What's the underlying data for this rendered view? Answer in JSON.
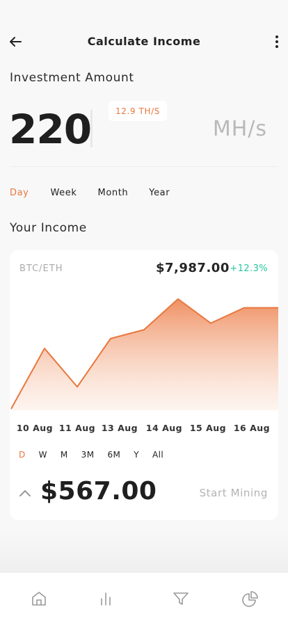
{
  "header": {
    "title": "Calculate Income",
    "back_icon": "arrow-left-icon",
    "menu_icon": "more-vertical-icon"
  },
  "investment": {
    "label": "Investment Amount",
    "amount": "220",
    "hashrate_badge": "12.9 TH/S",
    "unit": "MH/s"
  },
  "period_tabs": [
    "Day",
    "Week",
    "Month",
    "Year"
  ],
  "period_active": "Day",
  "income": {
    "label": "Your Income",
    "pair": "BTC/ETH",
    "price": "$7,987.00",
    "change": "+12.3%",
    "ranges": [
      "D",
      "W",
      "M",
      "3M",
      "6M",
      "Y",
      "All"
    ],
    "range_active": "D",
    "value": "$567.00",
    "start_button": "Start Mining",
    "expand_icon": "chevron-up-icon"
  },
  "chart_data": {
    "type": "area",
    "x": [
      "10 Aug",
      "11 Aug",
      "13 Aug",
      "14 Aug",
      "15 Aug",
      "16 Aug"
    ],
    "values": [
      0,
      0.55,
      0.2,
      0.64,
      0.72,
      1.0,
      0.78,
      0.92,
      0.92
    ]
  },
  "colors": {
    "accent": "#e8773d",
    "positive": "#27c5a0",
    "background": "#f8f8f8"
  },
  "bottom_nav": [
    {
      "icon": "home-icon"
    },
    {
      "icon": "bar-chart-icon"
    },
    {
      "icon": "filter-icon"
    },
    {
      "icon": "pie-chart-icon"
    }
  ]
}
